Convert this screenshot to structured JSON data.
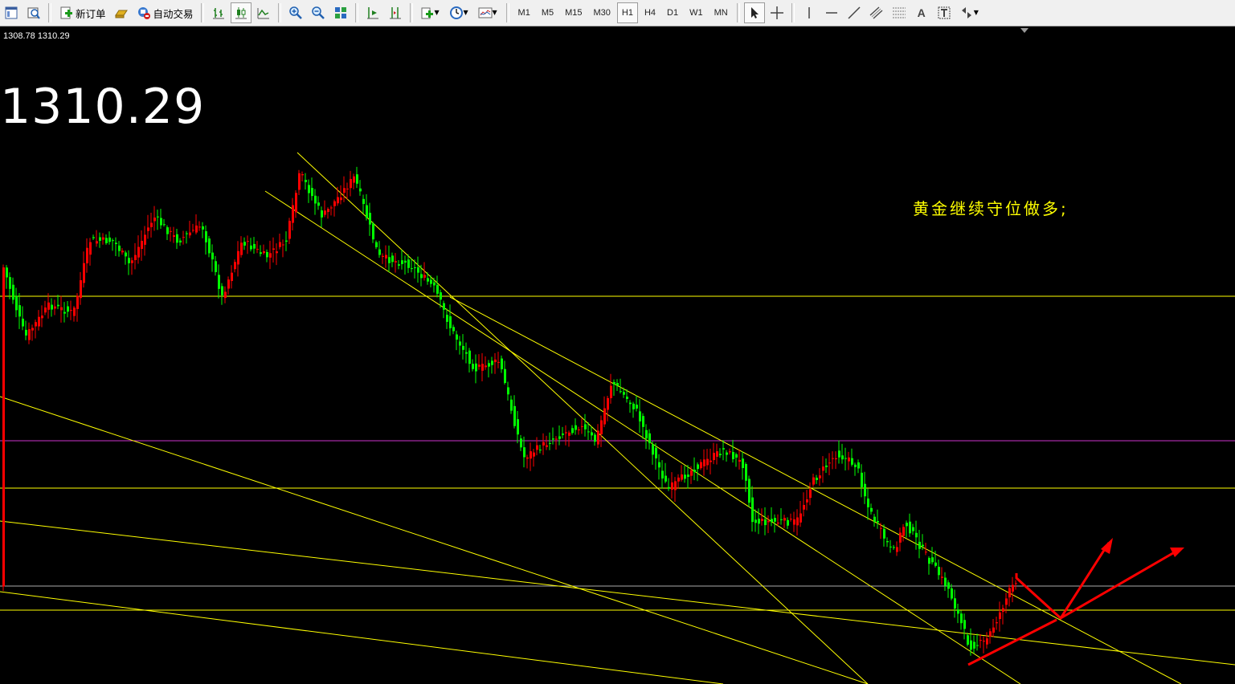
{
  "toolbar": {
    "new_order_label": "新订单",
    "auto_trading_label": "自动交易",
    "timeframes": [
      "M1",
      "M5",
      "M15",
      "M30",
      "H1",
      "H4",
      "D1",
      "W1",
      "MN"
    ],
    "active_timeframe": "H1",
    "text_tool_label": "A"
  },
  "chart": {
    "ohlc_readout": "1308.78 1310.29",
    "big_price": "1310.29",
    "note_text": "黄金继续守位做多;",
    "colors": {
      "background": "#000000",
      "bull_candle": "#ff0000",
      "bear_candle": "#00ff00",
      "support_line": "#ffff00",
      "level_line_magenta": "#cc33cc",
      "arrow": "#ff0000",
      "note": "#ffff00"
    }
  }
}
